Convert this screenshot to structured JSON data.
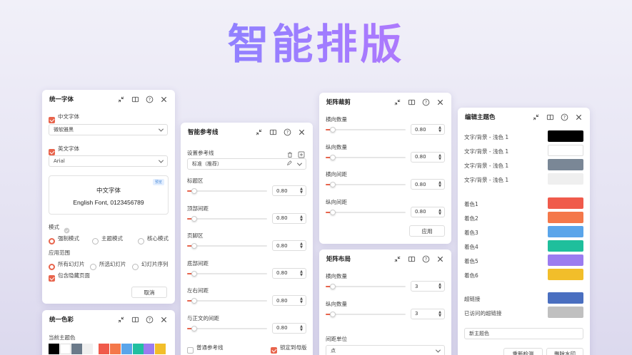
{
  "hero": {
    "title": "智能排版"
  },
  "fonts_panel": {
    "title": "统一字体",
    "cn_font": {
      "label": "中文字体",
      "value": "微软雅黑"
    },
    "en_font": {
      "label": "英文字体",
      "value": "Arial"
    },
    "preview": {
      "tag": "预览",
      "cn_text": "中文字体",
      "en_text": "English Font, 0123456789"
    },
    "mode": {
      "label": "模式",
      "options": [
        "强制模式",
        "主题模式",
        "核心模式"
      ]
    },
    "scope": {
      "label": "应用范围",
      "options": [
        "所有幻灯片",
        "所选幻灯片",
        "幻灯片序列"
      ]
    },
    "hidden_pages": "包含隐藏页面",
    "cancel": "取消"
  },
  "color_panel": {
    "title": "统一色彩",
    "current_theme_label": "当前主题色",
    "colors": [
      "#000000",
      "#ffffff",
      "#6b7a8a",
      "#f0f0f0",
      "#f05a4b",
      "#f4784a",
      "#5aa5ea",
      "#20bfa0",
      "#9b7cf0",
      "#f2be2a"
    ]
  },
  "guides_panel": {
    "title": "智能参考线",
    "set_label": "设置参考线",
    "preset": "标准（推荐）",
    "rows": [
      {
        "label": "标题区",
        "value": "0.80"
      },
      {
        "label": "顶部间距",
        "value": "0.80"
      },
      {
        "label": "页脚区",
        "value": "0.80"
      },
      {
        "label": "底部间距",
        "value": "0.80"
      },
      {
        "label": "左右间距",
        "value": "0.80"
      },
      {
        "label": "与正文的间距",
        "value": "0.80"
      }
    ],
    "normal_guides": "普通参考线",
    "lock_master": "锁定到母版"
  },
  "crop_panel": {
    "title": "矩阵裁剪",
    "rows": [
      {
        "label": "横向数量",
        "value": "0.80"
      },
      {
        "label": "纵向数量",
        "value": "0.80"
      },
      {
        "label": "横向间距",
        "value": "0.80"
      },
      {
        "label": "纵向间距",
        "value": "0.80"
      }
    ],
    "apply": "应用"
  },
  "layout_panel": {
    "title": "矩阵布局",
    "rows": [
      {
        "label": "横向数量",
        "value": "3"
      },
      {
        "label": "纵向数量",
        "value": "3"
      }
    ],
    "unit": {
      "label": "间距单位",
      "value": "点"
    }
  },
  "theme_panel": {
    "title": "编辑主题色",
    "text_bg": [
      {
        "label": "文字/背景 - 浅色 1",
        "color": "#000000"
      },
      {
        "label": "文字/背景 - 浅色 1",
        "color": "#ffffff"
      },
      {
        "label": "文字/背景 - 浅色 1",
        "color": "#7a8796"
      },
      {
        "label": "文字/背景 - 浅色 1",
        "color": "#efefef"
      }
    ],
    "accents": [
      {
        "label": "着色1",
        "color": "#f05a4b"
      },
      {
        "label": "着色2",
        "color": "#f4784a"
      },
      {
        "label": "着色3",
        "color": "#5aa5ea"
      },
      {
        "label": "着色4",
        "color": "#1fbf9c"
      },
      {
        "label": "着色5",
        "color": "#9b7cf0"
      },
      {
        "label": "着色6",
        "color": "#f2be2a"
      }
    ],
    "links": [
      {
        "label": "超链接",
        "color": "#4a6fc0"
      },
      {
        "label": "已访问的超链接",
        "color": "#c0c0c0"
      }
    ],
    "new_theme_placeholder": "新主题色",
    "reset": "重新检测",
    "delete_watermark": "删除水印"
  },
  "accent_color": "#e8644c"
}
